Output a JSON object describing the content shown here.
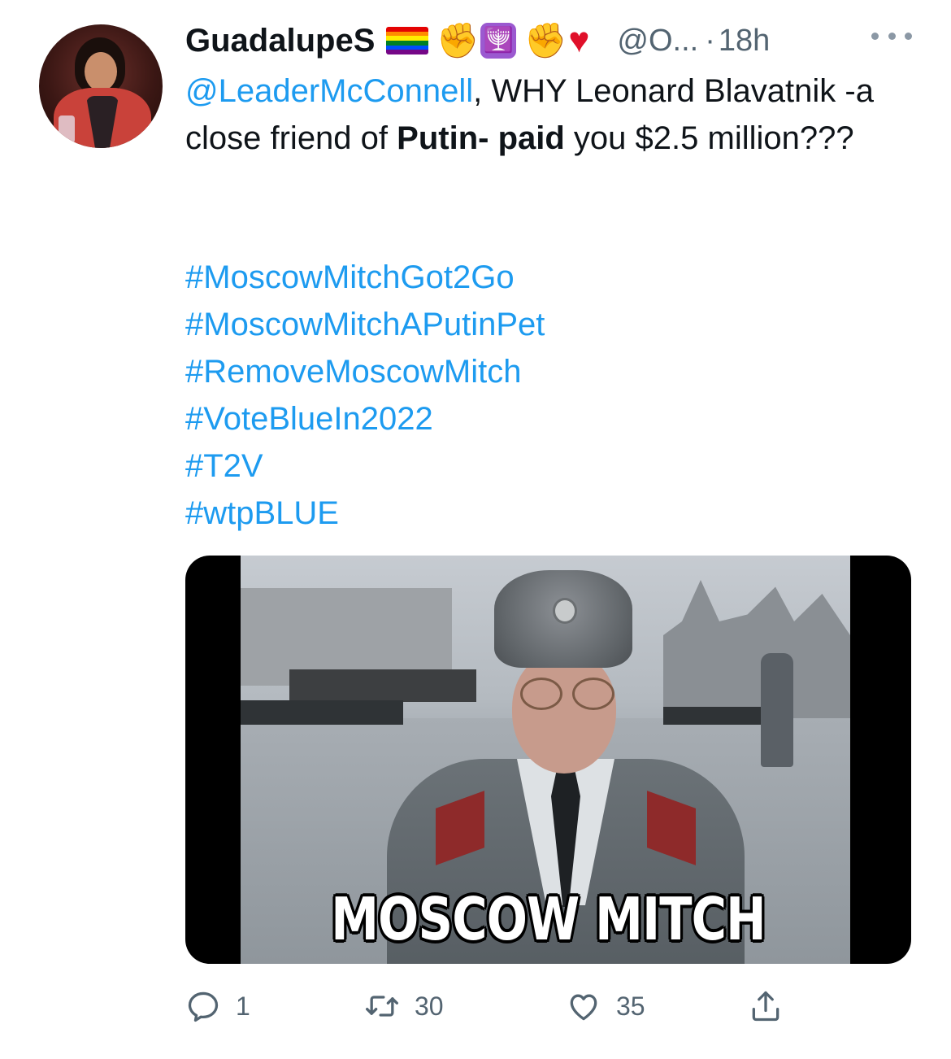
{
  "tweet": {
    "author": {
      "display_name": "GuadalupeS",
      "handle": "@O...",
      "time_sep": "·",
      "time": "18h",
      "emojis": [
        "rainbow-flag",
        "raised-fist-dark",
        "menorah",
        "raised-fist-medium",
        "red-heart"
      ]
    },
    "text": {
      "mention": "@LeaderMcConnell",
      "part1": ", WHY Leonard Blavatnik -a close friend of ",
      "bold1": "Putin-",
      "space": " ",
      "bold2": "paid",
      "part2": " you $2.5 million???"
    },
    "hashtags": [
      "#MoscowMitchGot2Go",
      "#MoscowMitchAPutinPet",
      "#RemoveMoscowMitch",
      "#VoteBlueIn2022",
      "#T2V",
      "#wtpBLUE"
    ],
    "media": {
      "caption": "MOSCOW MITCH"
    },
    "actions": {
      "replies": "1",
      "retweets": "30",
      "likes": "35"
    }
  },
  "colors": {
    "link": "#1d9bf0",
    "muted": "#536471",
    "text": "#0f1419"
  }
}
